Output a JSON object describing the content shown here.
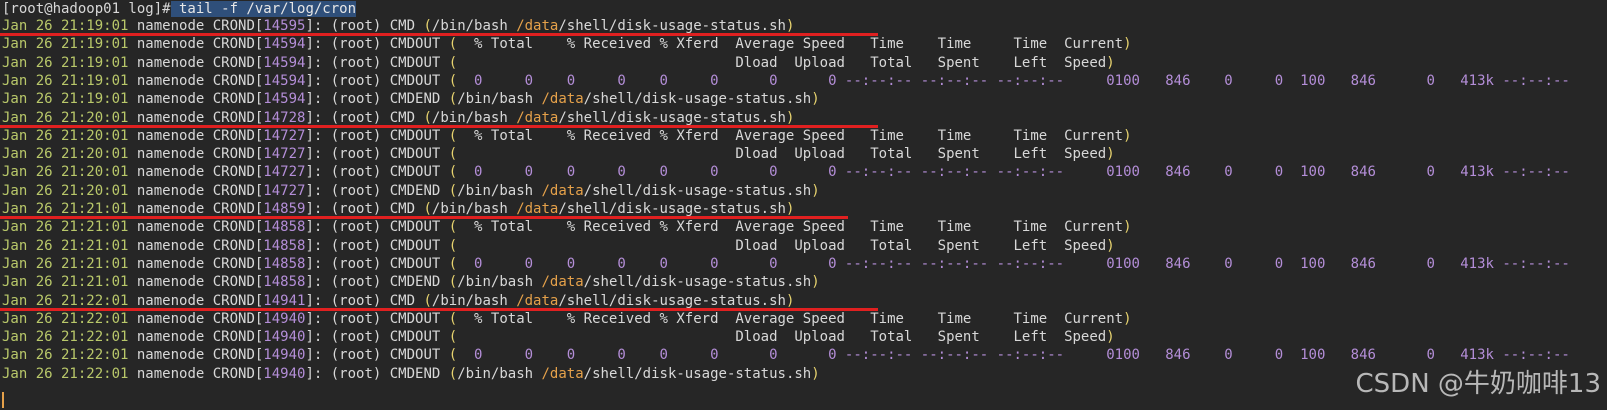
{
  "colors": {
    "background": "#262626",
    "date": "#b9c86a",
    "pid": "#b48ed8",
    "path_dir": "#e5a14a",
    "paren": "#e7d36f",
    "underline": "#e02020",
    "selection": "#2f4f7a"
  },
  "prompt": {
    "text": "[root@hadoop01 log]#",
    "command": " tail -f /var/log/cron"
  },
  "common": {
    "host": "namenode",
    "proc": "CROND",
    "user": "(root)",
    "bash": "/bin/bash",
    "data_dir": "/data",
    "script": "/shell/disk-usage-status.sh",
    "hdr1": "  % Total    % Received % Xferd  Average Speed   Time    Time     Time  Current",
    "hdr2": "                                 Dload  Upload   Total   Spent    Left  Speed",
    "row_a": "  0     0    0     0    0     0      0      0 --:--:-- --:--:-- --:--:--     0",
    "row_b": "100   846    0     0  100   846      0   413k --:--:--"
  },
  "cycles": [
    {
      "time": "Jan 26 21:19:01",
      "cmd_pid": "14595",
      "out_pid": "14594"
    },
    {
      "time": "Jan 26 21:20:01",
      "cmd_pid": "14728",
      "out_pid": "14727"
    },
    {
      "time": "Jan 26 21:21:01",
      "cmd_pid": "14859",
      "out_pid": "14858"
    },
    {
      "time": "Jan 26 21:22:01",
      "cmd_pid": "14941",
      "out_pid": "14940"
    }
  ],
  "watermark": "CSDN @牛奶咖啡13"
}
